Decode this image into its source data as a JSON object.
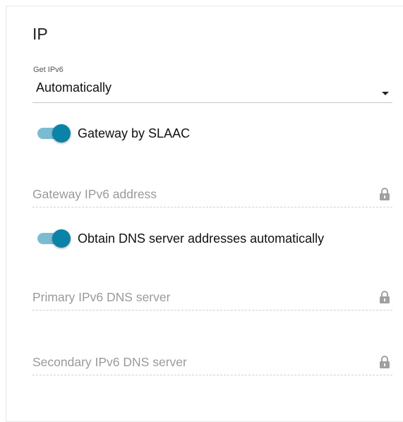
{
  "section": {
    "title": "IP"
  },
  "get_ipv6": {
    "caption": "Get IPv6",
    "value": "Automatically",
    "arrow_icon": "dropdown-arrow-icon"
  },
  "toggles": [
    {
      "label": "Gateway by SLAAC",
      "on": true
    },
    {
      "label": "Obtain DNS server addresses automatically",
      "on": true
    }
  ],
  "fields": [
    {
      "placeholder": "Gateway IPv6 address",
      "locked": true,
      "icon": "lock-icon"
    },
    {
      "placeholder": "Primary IPv6 DNS server",
      "locked": true,
      "icon": "lock-icon"
    },
    {
      "placeholder": "Secondary IPv6 DNS server",
      "locked": true,
      "icon": "lock-icon"
    }
  ],
  "colors": {
    "toggle_knob": "#0b82a8",
    "toggle_track": "#7cbcd2",
    "placeholder": "#9a9a9a",
    "lock": "#a0a0a0"
  }
}
